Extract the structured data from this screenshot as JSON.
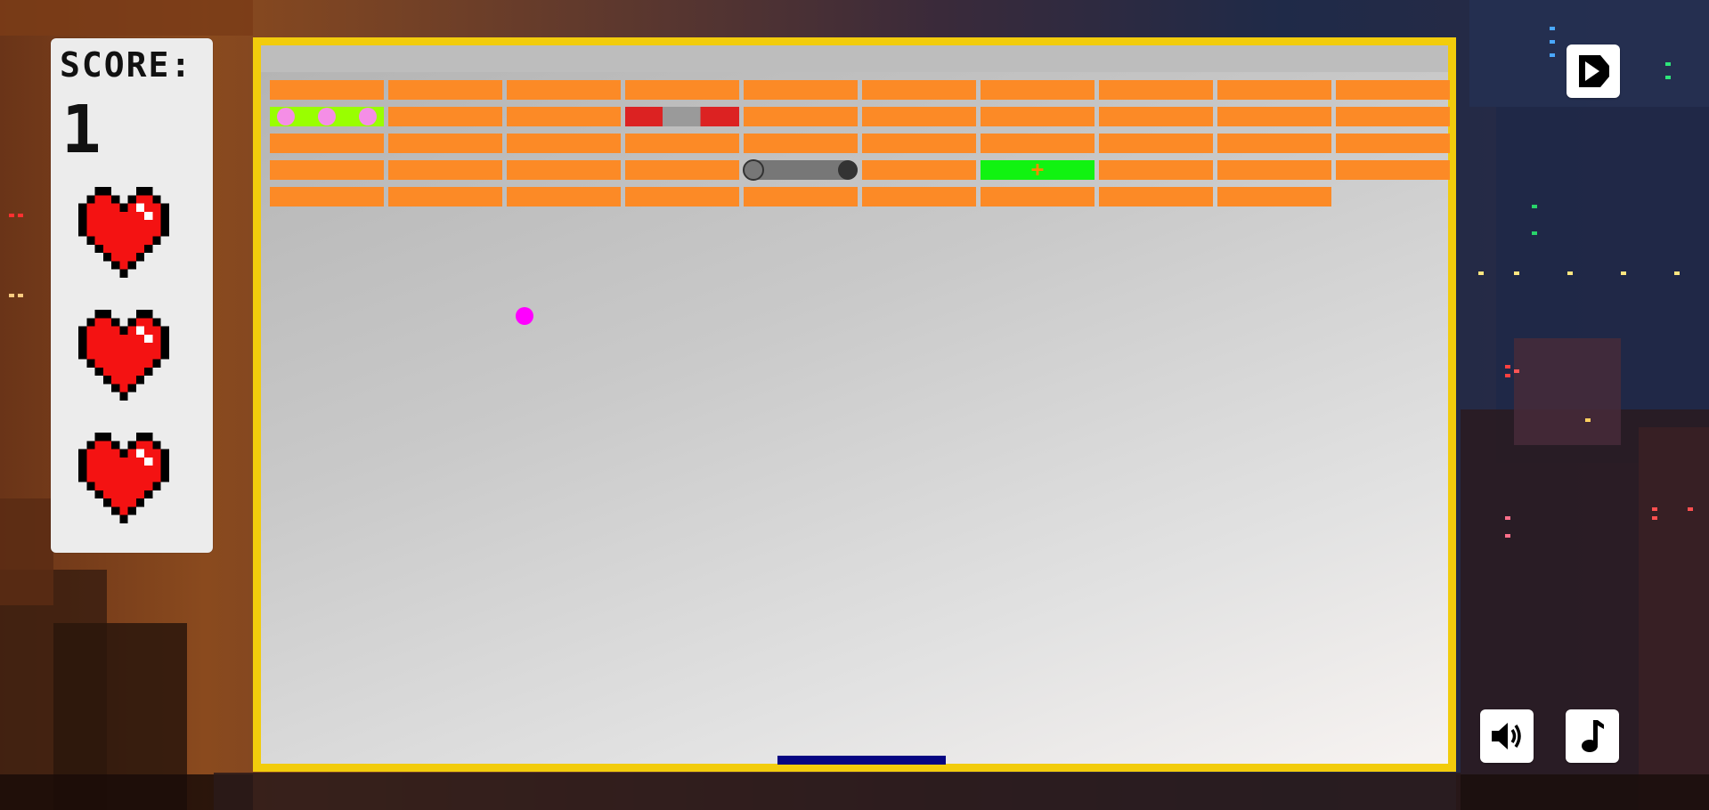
{
  "score": {
    "label": "SCORE:",
    "value": "1"
  },
  "lives": {
    "count": 3,
    "icon": "pixel-heart-icon"
  },
  "board": {
    "columns": 10,
    "rows": [
      [
        "normal",
        "normal",
        "normal",
        "normal",
        "normal",
        "normal",
        "normal",
        "normal",
        "normal",
        "normal"
      ],
      [
        "multiball",
        "normal",
        "normal",
        "blocked",
        "normal",
        "normal",
        "normal",
        "normal",
        "normal",
        "normal"
      ],
      [
        "normal",
        "normal",
        "normal",
        "normal",
        "normal",
        "normal",
        "normal",
        "normal",
        "normal",
        "normal"
      ],
      [
        "normal",
        "normal",
        "normal",
        "normal",
        "paddle-extend",
        "normal",
        "extra-life",
        "normal",
        "normal",
        "normal"
      ],
      [
        "normal",
        "normal",
        "normal",
        "normal",
        "normal",
        "normal",
        "normal",
        "normal",
        "normal",
        "empty"
      ]
    ]
  },
  "colors": {
    "border": "#f2cc0c",
    "brick": "#fc8a26",
    "ball": "#ff00ff",
    "paddle": "#060682",
    "multiball_bg": "#99ff00",
    "multiball_dot": "#f58ee6",
    "blocked_red": "#dc2222",
    "blocked_grey": "#9a9a9a",
    "extend_bar": "#777777",
    "extend_dot": "#333333",
    "life_bg": "#11f311",
    "life_plus": "#ff8a00",
    "heart_red": "#f41212"
  },
  "controls": {
    "play": "play-icon",
    "sound": "speaker-icon",
    "music": "music-note-icon"
  }
}
